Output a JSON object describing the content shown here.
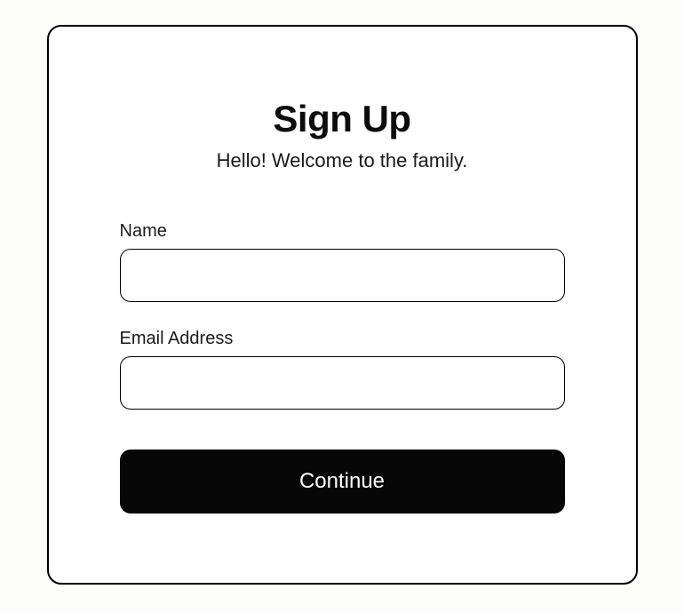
{
  "signup": {
    "heading": "Sign Up",
    "subheading": "Hello! Welcome to the family.",
    "fields": {
      "name": {
        "label": "Name",
        "value": ""
      },
      "email": {
        "label": "Email Address",
        "value": ""
      }
    },
    "submit_label": "Continue"
  }
}
